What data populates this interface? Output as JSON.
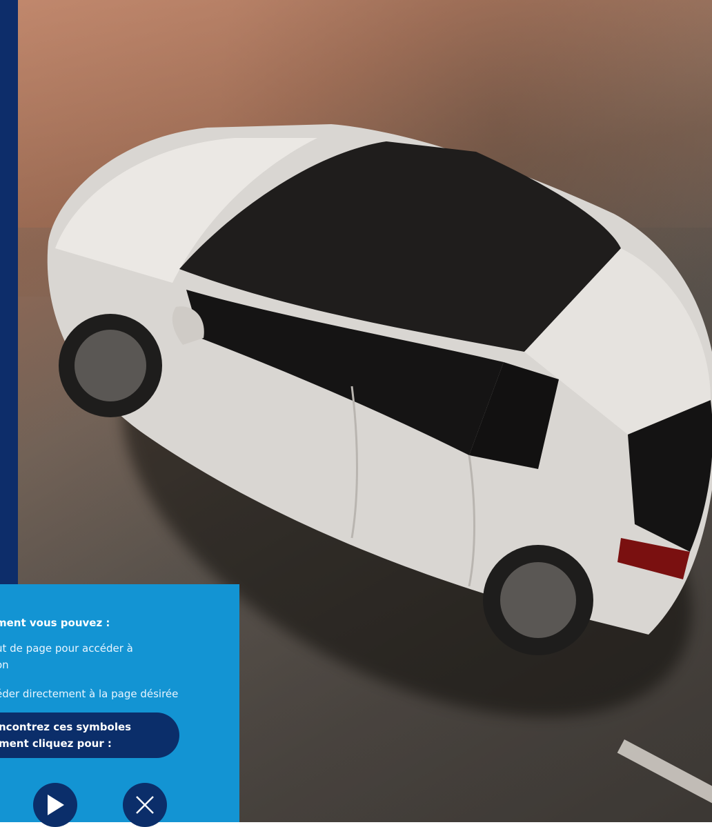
{
  "panel": {
    "heading": "ment vous pouvez :",
    "line1": "ut de page pour accéder à",
    "line2": "on",
    "line3": "éder directement à la page désirée",
    "pill_line1": "ncontrez ces symboles",
    "pill_line2": "ment cliquez pour :"
  },
  "icons": {
    "play": "play-icon",
    "close": "close-icon"
  },
  "colors": {
    "panel_blue": "#1394d3",
    "navy": "#0b2e6a",
    "strip_navy": "#0d2d6a"
  }
}
